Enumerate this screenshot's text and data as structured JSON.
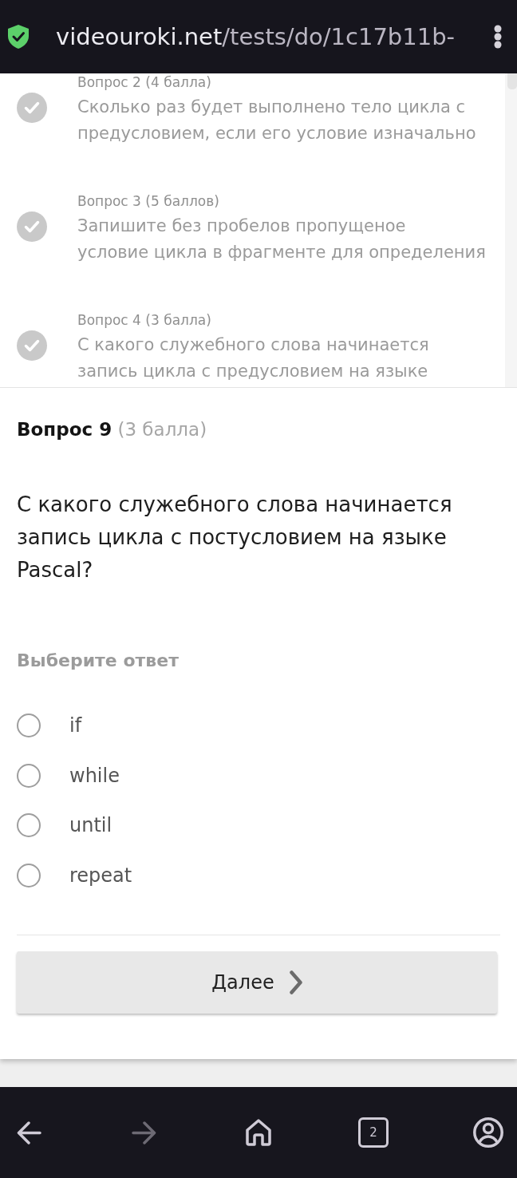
{
  "browser_bar": {
    "url_host": "videouroki.net",
    "url_path": "/tests/do/1c17b11b-"
  },
  "question_list": [
    {
      "label": "Вопрос 2 (4 балла)",
      "text": "Сколько раз будет выполнено тело цикла с\nпредусловием, если его условие изначально",
      "answered": true
    },
    {
      "label": "Вопрос 3 (5 баллов)",
      "text": "Запишите без пробелов пропущеное\nусловие цикла в фрагменте для определения",
      "answered": true
    },
    {
      "label": "Вопрос 4 (3 балла)",
      "text": "С какого служебного слова начинается\nзапись цикла с предусловием на языке",
      "answered": true
    }
  ],
  "question": {
    "number": "Вопрос 9",
    "points": "(3 балла)",
    "text": "С какого служебного слова начинается запись цикла с постусловием на языке Pascal?"
  },
  "answer_prompt": "Выберите ответ",
  "options": [
    {
      "label": "if",
      "selected": false
    },
    {
      "label": "while",
      "selected": false
    },
    {
      "label": "until",
      "selected": false
    },
    {
      "label": "repeat",
      "selected": false
    }
  ],
  "next_button": {
    "label": "Далее"
  },
  "nav_bar": [
    {
      "kind": "back",
      "disabled": false
    },
    {
      "kind": "forward",
      "disabled": true
    },
    {
      "kind": "home",
      "disabled": false
    },
    {
      "kind": "tabs",
      "count": "2",
      "disabled": false
    },
    {
      "kind": "account",
      "disabled": false
    }
  ]
}
